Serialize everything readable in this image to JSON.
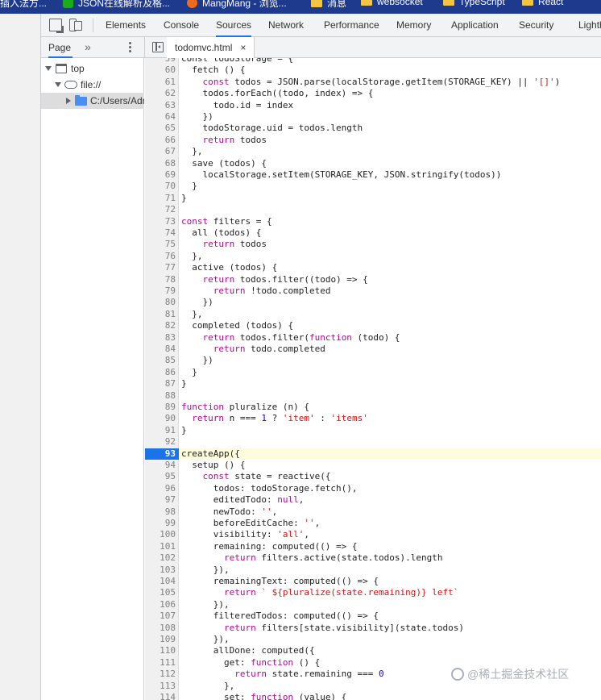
{
  "bookmarks": [
    {
      "label": "插入法方...",
      "icon": "none"
    },
    {
      "label": "JSON在线解析及格...",
      "icon": "green-app-icon"
    },
    {
      "label": "MangMang - 浏览...",
      "icon": "orange-app-icon"
    },
    {
      "label": "消息",
      "icon": "folder-icon"
    },
    {
      "label": "websocket",
      "icon": "folder-icon"
    },
    {
      "label": "TypeScript",
      "icon": "folder-icon"
    },
    {
      "label": "React",
      "icon": "folder-icon"
    }
  ],
  "devtools": {
    "tabs": [
      "Elements",
      "Console",
      "Sources",
      "Network",
      "Performance",
      "Memory",
      "Application",
      "Security",
      "Lighth"
    ],
    "active_tab": "Sources",
    "navigator_tab": "Page",
    "more_tabs": "»",
    "file_tab": "todomvc.html",
    "file_close": "×"
  },
  "tree": {
    "top": "top",
    "origin": "file://",
    "folder": "C:/Users/Adr"
  },
  "editor": {
    "current_line": 93,
    "lines": [
      {
        "n": "59",
        "t": [
          [
            "p",
            "const todoStorage = {"
          ]
        ]
      },
      {
        "n": "60",
        "t": [
          [
            "p",
            "  fetch () {"
          ]
        ]
      },
      {
        "n": "61",
        "t": [
          [
            "k",
            "    const"
          ],
          [
            "p",
            " todos = JSON.parse(localStorage.getItem(STORAGE_KEY) || "
          ],
          [
            "s",
            "'[]'"
          ],
          [
            "p",
            ")"
          ]
        ]
      },
      {
        "n": "62",
        "t": [
          [
            "p",
            "    todos.forEach((todo, index) => {"
          ]
        ]
      },
      {
        "n": "63",
        "t": [
          [
            "p",
            "      todo.id = index"
          ]
        ]
      },
      {
        "n": "64",
        "t": [
          [
            "p",
            "    })"
          ]
        ]
      },
      {
        "n": "65",
        "t": [
          [
            "p",
            "    todoStorage.uid = todos.length"
          ]
        ]
      },
      {
        "n": "66",
        "t": [
          [
            "k",
            "    return"
          ],
          [
            "p",
            " todos"
          ]
        ]
      },
      {
        "n": "67",
        "t": [
          [
            "p",
            "  },"
          ]
        ]
      },
      {
        "n": "68",
        "t": [
          [
            "p",
            "  save (todos) {"
          ]
        ]
      },
      {
        "n": "69",
        "t": [
          [
            "p",
            "    localStorage.setItem(STORAGE_KEY, JSON.stringify(todos))"
          ]
        ]
      },
      {
        "n": "70",
        "t": [
          [
            "p",
            "  }"
          ]
        ]
      },
      {
        "n": "71",
        "t": [
          [
            "p",
            "}"
          ]
        ]
      },
      {
        "n": "72",
        "t": [
          [
            "p",
            ""
          ]
        ]
      },
      {
        "n": "73",
        "t": [
          [
            "k",
            "const"
          ],
          [
            "p",
            " filters = {"
          ]
        ]
      },
      {
        "n": "74",
        "t": [
          [
            "p",
            "  all (todos) {"
          ]
        ]
      },
      {
        "n": "75",
        "t": [
          [
            "k",
            "    return"
          ],
          [
            "p",
            " todos"
          ]
        ]
      },
      {
        "n": "76",
        "t": [
          [
            "p",
            "  },"
          ]
        ]
      },
      {
        "n": "77",
        "t": [
          [
            "p",
            "  active (todos) {"
          ]
        ]
      },
      {
        "n": "78",
        "t": [
          [
            "k",
            "    return"
          ],
          [
            "p",
            " todos.filter((todo) => {"
          ]
        ]
      },
      {
        "n": "79",
        "t": [
          [
            "k",
            "      return"
          ],
          [
            "p",
            " !todo.completed"
          ]
        ]
      },
      {
        "n": "80",
        "t": [
          [
            "p",
            "    })"
          ]
        ]
      },
      {
        "n": "81",
        "t": [
          [
            "p",
            "  },"
          ]
        ]
      },
      {
        "n": "82",
        "t": [
          [
            "p",
            "  completed (todos) {"
          ]
        ]
      },
      {
        "n": "83",
        "t": [
          [
            "k",
            "    return"
          ],
          [
            "p",
            " todos.filter("
          ],
          [
            "k",
            "function"
          ],
          [
            "p",
            " (todo) {"
          ]
        ]
      },
      {
        "n": "84",
        "t": [
          [
            "k",
            "      return"
          ],
          [
            "p",
            " todo.completed"
          ]
        ]
      },
      {
        "n": "85",
        "t": [
          [
            "p",
            "    })"
          ]
        ]
      },
      {
        "n": "86",
        "t": [
          [
            "p",
            "  }"
          ]
        ]
      },
      {
        "n": "87",
        "t": [
          [
            "p",
            "}"
          ]
        ]
      },
      {
        "n": "88",
        "t": [
          [
            "p",
            ""
          ]
        ]
      },
      {
        "n": "89",
        "t": [
          [
            "k",
            "function"
          ],
          [
            "p",
            " pluralize (n) {"
          ]
        ]
      },
      {
        "n": "90",
        "t": [
          [
            "k",
            "  return"
          ],
          [
            "p",
            " n === "
          ],
          [
            "n",
            "1"
          ],
          [
            "p",
            " ? "
          ],
          [
            "s",
            "'item'"
          ],
          [
            "p",
            " : "
          ],
          [
            "s",
            "'items'"
          ]
        ]
      },
      {
        "n": "91",
        "t": [
          [
            "p",
            "}"
          ]
        ]
      },
      {
        "n": "92",
        "t": [
          [
            "p",
            ""
          ]
        ]
      },
      {
        "n": "93",
        "t": [
          [
            "p",
            "createApp({"
          ]
        ]
      },
      {
        "n": "94",
        "t": [
          [
            "p",
            "  setup () {"
          ]
        ]
      },
      {
        "n": "95",
        "t": [
          [
            "k",
            "    const"
          ],
          [
            "p",
            " state = reactive({"
          ]
        ]
      },
      {
        "n": "96",
        "t": [
          [
            "p",
            "      todos: todoStorage.fetch(),"
          ]
        ]
      },
      {
        "n": "97",
        "t": [
          [
            "p",
            "      editedTodo: "
          ],
          [
            "k",
            "null"
          ],
          [
            "p",
            ","
          ]
        ]
      },
      {
        "n": "98",
        "t": [
          [
            "p",
            "      newTodo: "
          ],
          [
            "s",
            "''"
          ],
          [
            "p",
            ","
          ]
        ]
      },
      {
        "n": "99",
        "t": [
          [
            "p",
            "      beforeEditCache: "
          ],
          [
            "s",
            "''"
          ],
          [
            "p",
            ","
          ]
        ]
      },
      {
        "n": "100",
        "t": [
          [
            "p",
            "      visibility: "
          ],
          [
            "s",
            "'all'"
          ],
          [
            "p",
            ","
          ]
        ]
      },
      {
        "n": "101",
        "t": [
          [
            "p",
            "      remaining: computed(() => {"
          ]
        ]
      },
      {
        "n": "102",
        "t": [
          [
            "k",
            "        return"
          ],
          [
            "p",
            " filters.active(state.todos).length"
          ]
        ]
      },
      {
        "n": "103",
        "t": [
          [
            "p",
            "      }),"
          ]
        ]
      },
      {
        "n": "104",
        "t": [
          [
            "p",
            "      remainingText: computed(() => {"
          ]
        ]
      },
      {
        "n": "105",
        "t": [
          [
            "k",
            "        return"
          ],
          [
            "s",
            " ` ${pluralize(state.remaining)} left`"
          ]
        ]
      },
      {
        "n": "106",
        "t": [
          [
            "p",
            "      }),"
          ]
        ]
      },
      {
        "n": "107",
        "t": [
          [
            "p",
            "      filteredTodos: computed(() => {"
          ]
        ]
      },
      {
        "n": "108",
        "t": [
          [
            "k",
            "        return"
          ],
          [
            "p",
            " filters[state.visibility](state.todos)"
          ]
        ]
      },
      {
        "n": "109",
        "t": [
          [
            "p",
            "      }),"
          ]
        ]
      },
      {
        "n": "110",
        "t": [
          [
            "p",
            "      allDone: computed({"
          ]
        ]
      },
      {
        "n": "111",
        "t": [
          [
            "p",
            "        get: "
          ],
          [
            "k",
            "function"
          ],
          [
            "p",
            " () {"
          ]
        ]
      },
      {
        "n": "112",
        "t": [
          [
            "k",
            "          return"
          ],
          [
            "p",
            " state.remaining === "
          ],
          [
            "n",
            "0"
          ]
        ]
      },
      {
        "n": "113",
        "t": [
          [
            "p",
            "        },"
          ]
        ]
      },
      {
        "n": "114",
        "t": [
          [
            "p",
            "        set: "
          ],
          [
            "k",
            "function"
          ],
          [
            "p",
            " (value) {"
          ]
        ]
      }
    ]
  },
  "watermark": "@稀土掘金技术社区"
}
